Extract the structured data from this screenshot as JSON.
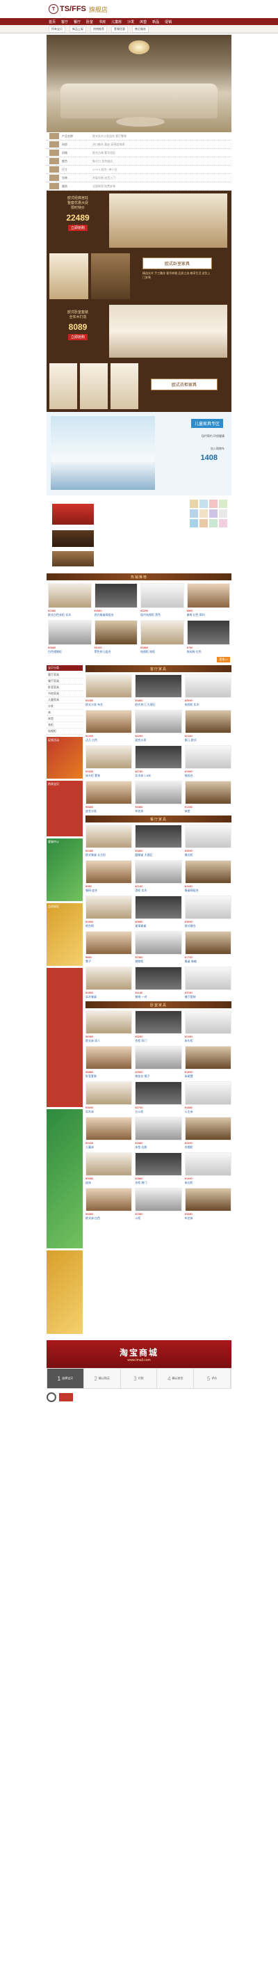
{
  "header": {
    "logo_text": "TS/FFS",
    "logo_sub": "旗舰店",
    "logo_mark": "T"
  },
  "nav": {
    "items": [
      "首页",
      "客厅",
      "餐厅",
      "卧室",
      "书房",
      "儿童房",
      "沙发",
      "床垫",
      "新品",
      "促销"
    ]
  },
  "sub_nav": {
    "items": [
      "所有宝贝",
      "新品上架",
      "热销推荐",
      "套餐优惠",
      "售后服务"
    ]
  },
  "params": [
    {
      "label": "产品名称",
      "value": "欧式实木沙发组合 客厅整装"
    },
    {
      "label": "材质",
      "value": "进口橡木 真皮 高密度海绵"
    },
    {
      "label": "风格",
      "value": "欧式古典 奢华宫廷"
    },
    {
      "label": "颜色",
      "value": "象牙白 金色描边"
    },
    {
      "label": "尺寸",
      "value": "1+2+3 组合 / 单人位"
    },
    {
      "label": "包装",
      "value": "木架包装 送货上门"
    },
    {
      "label": "服务",
      "value": "全国联保 免费安装"
    }
  ],
  "promo1": {
    "line1": "欧式经典宫廷",
    "line2": "整套优惠大促",
    "line3": "限时特价",
    "price": "22489",
    "button": "立即抢购"
  },
  "promo1_label": {
    "title": "欧式卧室家具",
    "text": "精选实木 手工雕花 奢华典雅 品质之选 尊享生活 送货上门安装"
  },
  "promo2": {
    "line1": "欧式卧室套装",
    "line2": "全实木打造",
    "price": "8089",
    "button": "立即抢购"
  },
  "promo3_label": {
    "title": "欧式衣柜家具"
  },
  "kids": {
    "title": "儿童家具专区",
    "subtitle": "现代简约 环保健康",
    "price": "1408",
    "cart": "加入购物车"
  },
  "sofa_banner": {
    "swatches": [
      "#e8d6a8",
      "#c7e0ef",
      "#f2c4c4",
      "#d8ecc9",
      "#b8d4e8",
      "#f0e2c4",
      "#cfc3e6",
      "#e9e9e9",
      "#a6d3e8",
      "#e8c8a6",
      "#c8e8d0",
      "#f3d0e0"
    ]
  },
  "section1": {
    "title": "热销推荐"
  },
  "grid1": [
    {
      "price": "¥2380",
      "desc": "欧式白色衣柜 实木"
    },
    {
      "price": "¥4580",
      "desc": "欧式餐桌椅组合"
    },
    {
      "price": "¥3290",
      "desc": "现代电视柜 黑色"
    },
    {
      "price": "¥890",
      "desc": "餐椅 红色 简约"
    },
    {
      "price": "¥2680",
      "desc": "白色储物柜"
    },
    {
      "price": "¥5190",
      "desc": "黑色茶几组合"
    },
    {
      "price": "¥3860",
      "desc": "电视柜 地柜"
    },
    {
      "price": "¥760",
      "desc": "休闲椅 红色"
    }
  ],
  "more": {
    "label": "更多>>"
  },
  "sidebar": {
    "head": "宝贝分类",
    "items": [
      "客厅家具",
      "餐厅家具",
      "卧室家具",
      "书房家具",
      "儿童家具",
      "沙发",
      "床",
      "床垫",
      "衣柜",
      "电视柜"
    ],
    "block1": "促销活动",
    "block2": "热卖宝贝",
    "block3": "客服中心",
    "block4": "品质保证"
  },
  "section2": {
    "title": "客厅家具"
  },
  "section3": {
    "title": "餐厅家具"
  },
  "section4": {
    "title": "卧室家具"
  },
  "grid2": [
    {
      "price": "¥3280",
      "desc": "欧式沙发 布艺"
    },
    {
      "price": "¥1880",
      "desc": "欧式茶几 大理石"
    },
    {
      "price": "¥2590",
      "desc": "电视柜 实木"
    },
    {
      "price": "¥1490",
      "desc": "边几 白色"
    },
    {
      "price": "¥4290",
      "desc": "组合沙发"
    },
    {
      "price": "¥2160",
      "desc": "角几 欧式"
    },
    {
      "price": "¥3180",
      "desc": "床头柜 套装"
    },
    {
      "price": "¥2780",
      "desc": "实木床 1.8米"
    },
    {
      "price": "¥1960",
      "desc": "梳妆台"
    },
    {
      "price": "¥5680",
      "desc": "皮艺沙发"
    },
    {
      "price": "¥3380",
      "desc": "布艺床"
    },
    {
      "price": "¥1280",
      "desc": "床垫"
    }
  ],
  "grid3": [
    {
      "price": "¥2480",
      "desc": "欧式餐桌 长方形"
    },
    {
      "price": "¥1860",
      "desc": "圆餐桌 大理石"
    },
    {
      "price": "¥3390",
      "desc": "餐边柜"
    },
    {
      "price": "¥980",
      "desc": "餐椅 皮艺"
    },
    {
      "price": "¥2190",
      "desc": "酒柜 实木"
    },
    {
      "price": "¥4180",
      "desc": "餐桌椅组合"
    },
    {
      "price": "¥1590",
      "desc": "吧台椅"
    },
    {
      "price": "¥2680",
      "desc": "玻璃餐桌"
    },
    {
      "price": "¥3590",
      "desc": "欧式餐台"
    },
    {
      "price": "¥860",
      "desc": "凳子"
    },
    {
      "price": "¥2360",
      "desc": "储物柜"
    },
    {
      "price": "¥1790",
      "desc": "餐桌 伸缩"
    },
    {
      "price": "¥2890",
      "desc": "实木餐桌"
    },
    {
      "price": "¥1180",
      "desc": "餐椅 一对"
    },
    {
      "price": "¥3780",
      "desc": "餐厅套装"
    }
  ],
  "grid4": [
    {
      "price": "¥4980",
      "desc": "欧式床 双人"
    },
    {
      "price": "¥3280",
      "desc": "衣柜 四门"
    },
    {
      "price": "¥2180",
      "desc": "床头柜"
    },
    {
      "price": "¥5880",
      "desc": "卧室套装"
    },
    {
      "price": "¥2590",
      "desc": "梳妆台 镜子"
    },
    {
      "price": "¥1890",
      "desc": "床尾凳"
    },
    {
      "price": "¥3690",
      "desc": "实木床"
    },
    {
      "price": "¥2790",
      "desc": "五斗柜"
    },
    {
      "price": "¥4380",
      "desc": "公主床"
    },
    {
      "price": "¥3180",
      "desc": "儿童床"
    },
    {
      "price": "¥1680",
      "desc": "床垫 乳胶"
    },
    {
      "price": "¥2490",
      "desc": "衣帽柜"
    },
    {
      "price": "¥3980",
      "desc": "皮床"
    },
    {
      "price": "¥2880",
      "desc": "衣柜 移门"
    },
    {
      "price": "¥1590",
      "desc": "床边柜"
    },
    {
      "price": "¥4680",
      "desc": "欧式床 白色"
    },
    {
      "price": "¥2380",
      "desc": "斗柜"
    },
    {
      "price": "¥3380",
      "desc": "布艺床"
    }
  ],
  "footer": {
    "title": "淘宝商城",
    "url": "www.tmall.com"
  },
  "steps": [
    {
      "num": "1",
      "label": "选择宝贝"
    },
    {
      "num": "2",
      "label": "确认购买"
    },
    {
      "num": "3",
      "label": "付款"
    },
    {
      "num": "4",
      "label": "确认收货"
    },
    {
      "num": "5",
      "label": "评价"
    }
  ]
}
